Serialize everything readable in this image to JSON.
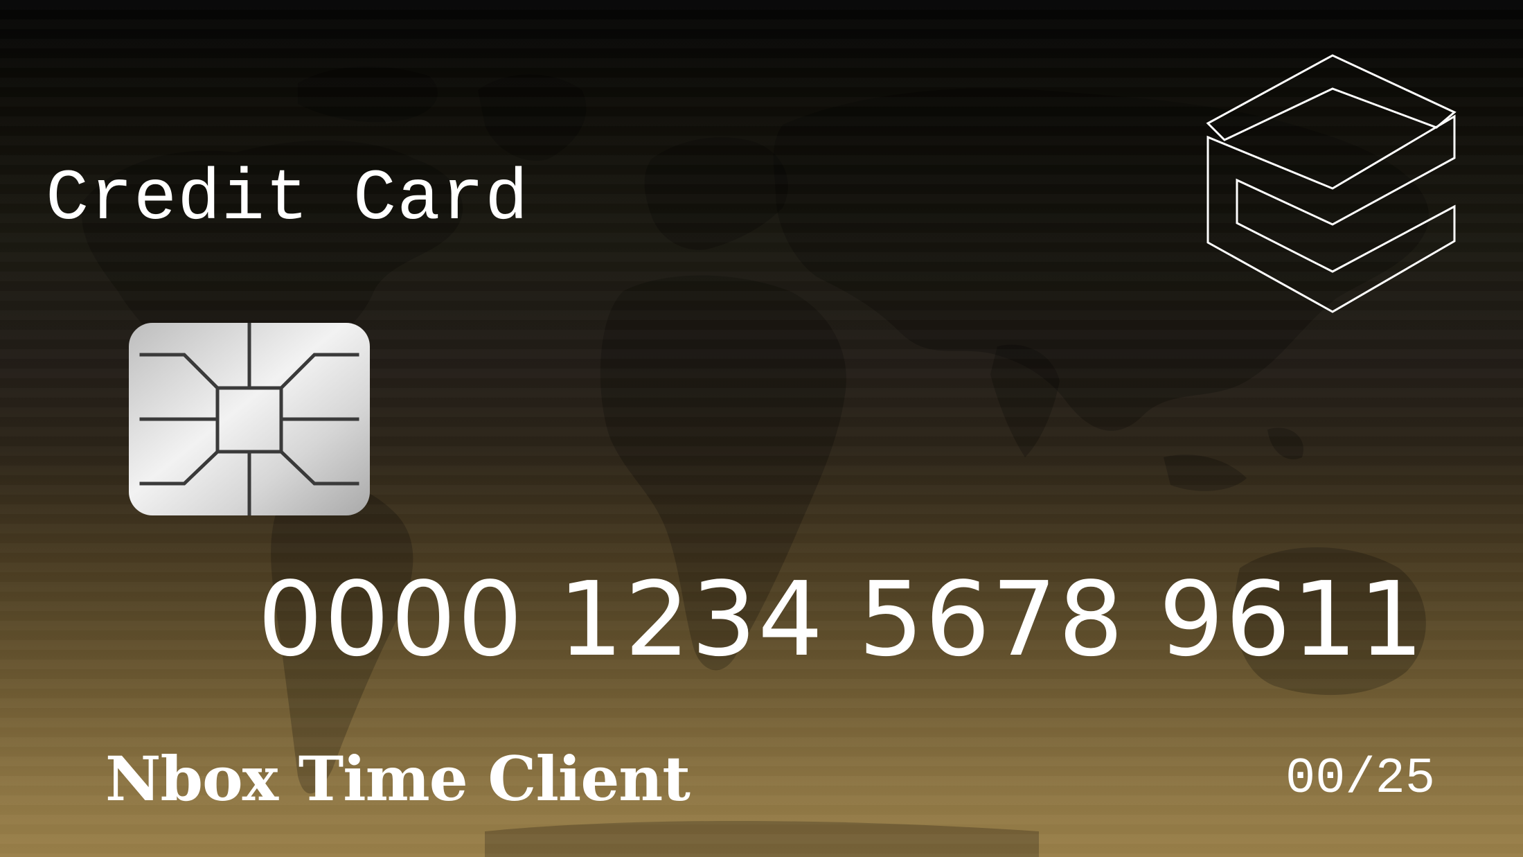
{
  "card": {
    "title": "Credit Card",
    "number": "0000 1234 5678 9611",
    "holder": "Nbox Time Client",
    "expiry": "00/25"
  },
  "icons": {
    "chip": "emv-chip-icon",
    "logo": "brand-logo-icon",
    "background": "world-map"
  },
  "colors": {
    "text": "#ffffff",
    "background_top": "#050505",
    "background_bottom": "#9a8049",
    "chip": "#d9d9d9"
  }
}
